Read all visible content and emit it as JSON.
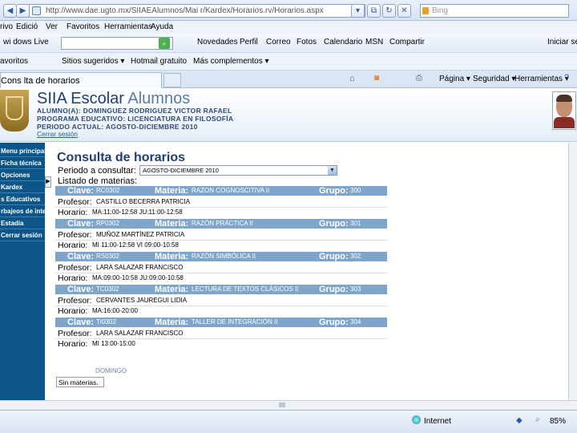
{
  "browser": {
    "address": "http://www.dae.ugto.mx/SIIAEAlumnos/Mai r/Kardex/Horarios.rv/Horarios.aspx",
    "search_placeholder": "Bing",
    "menu": [
      "rivo",
      "Edició",
      "Ver",
      "Favoritos",
      "Herramientas",
      "Ayuda"
    ],
    "wl_label": "wi dows Live",
    "wl_links": [
      "Novedades",
      "Perfil",
      "Correo",
      "Fotos",
      "Calendario",
      "MSN",
      "Compartir"
    ],
    "wl_right": "Iniciar sesi",
    "favorites_label": "avoritos",
    "favorites": [
      "Sitios sugeridos ▾",
      "Hotmail gratuito",
      "Más complementos ▾"
    ],
    "tab_title": "Cons lta de horarios",
    "commands": [
      "Página ▾",
      "Seguridad ▾",
      "Herramientas ▾"
    ]
  },
  "header": {
    "brand_main": "SIIA Escolar",
    "brand_sub": "Alumnos",
    "alumno": "ALUMNO(A): DOMINGUEZ RODRIGUEZ VICTOR RAFAEL",
    "programa": "PROGRAMA EDUCATIVO: LICENCIATURA EN FILOSOFÍA",
    "periodo": "PERIODO ACTUAL: AGOSTO-DICIEMBRE 2010",
    "logout": "Cerrar sesión"
  },
  "sidebar": {
    "items": [
      "Menu principal",
      "Ficha técnica",
      "Opciones",
      "Kardex",
      "s Educativos",
      "rbajeos de interés",
      "Estadía",
      "Cerrar sesión"
    ]
  },
  "main": {
    "title": "Consulta de horarios",
    "period_label": "Periodo a consultar:",
    "period_value": "AGOSTO-DICIEMBRE 2010",
    "listado": "Listado de materias:",
    "labels": {
      "clave": "Clave:",
      "materia": "Materia:",
      "grupo": "Grupo:",
      "profesor": "Profesor:",
      "horario": "Horario:"
    },
    "courses": [
      {
        "clave": "RC0302",
        "materia": "RAZON COGNOSCITIVA II",
        "grupo": "300",
        "profesor": "CASTILLO BECERRA PATRICIA",
        "horario": "MA:11:00-12:58 JU:11:00-12:58"
      },
      {
        "clave": "RP0302",
        "materia": "RAZÓN PRÁCTICA II",
        "grupo": "301",
        "profesor": "MUÑOZ MARTÍNEZ PATRICIA",
        "horario": "MI 11:00-12:58 VI 09:00-10:58"
      },
      {
        "clave": "RS0302",
        "materia": "RAZÓN SIMBÓLICA II",
        "grupo": "302",
        "profesor": "LARA SALAZAR FRANCISCO",
        "horario": "MA:09:00-10:58 JU:09:00-10:58"
      },
      {
        "clave": "TC0302",
        "materia": "LECTURA DE TEXTOS CLÁSICOS II",
        "grupo": "303",
        "profesor": "CERVANTES JAUREGUI LIDIA",
        "horario": "MA:16:00-20:00"
      },
      {
        "clave": "TI0302",
        "materia": "TALLER DE INTEGRACIÓN II",
        "grupo": "304",
        "profesor": "LARA SALAZAR FRANCISCO",
        "horario": "MI 13:00-15:00"
      }
    ],
    "domingo": "DOMINGO",
    "sin_materias": "Sin materias."
  },
  "status": {
    "zone": "Internet",
    "zoom": "85%"
  }
}
